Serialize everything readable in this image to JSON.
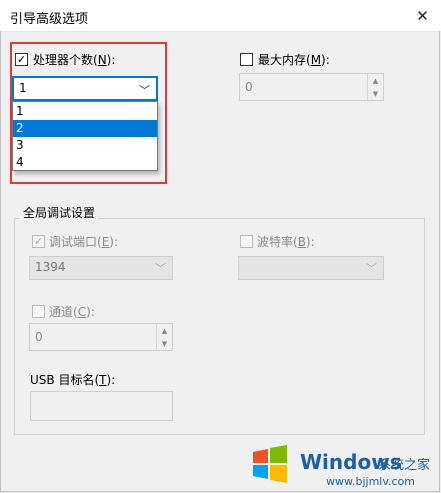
{
  "window": {
    "title": "引导高级选项",
    "close_glyph": "✕"
  },
  "processors": {
    "label_before": "处理器个数(",
    "label_key": "N",
    "label_after": "):",
    "checked": true,
    "selected": "1",
    "options": [
      "1",
      "2",
      "3",
      "4"
    ],
    "highlighted": "2"
  },
  "max_memory": {
    "label_before": "最大内存(",
    "label_key": "M",
    "label_after": "):",
    "checked": false,
    "value": "0"
  },
  "debug_settings": {
    "title": "全局调试设置",
    "debug_port": {
      "label_before": "调试端口(",
      "label_key": "E",
      "label_after": "):",
      "checked": true,
      "value": "1394"
    },
    "baud_rate": {
      "label_before": "波特率(",
      "label_key": "B",
      "label_after": "):",
      "checked": false,
      "value": ""
    },
    "channel": {
      "label_before": "通道(",
      "label_key": "C",
      "label_after": "):",
      "checked": false,
      "value": "0"
    },
    "usb_target": {
      "label_before": "USB 目标名(",
      "label_key": "T",
      "label_after": "):",
      "value": ""
    }
  },
  "watermark": {
    "brand": "Windows",
    "cn_text": "系统之家",
    "url": "www.bjjmlv.com",
    "colors": {
      "blue": "#1d5fa7",
      "red": "#f25022",
      "green": "#7fba00",
      "logo_blue": "#00a4ef",
      "yellow": "#ffb900"
    }
  },
  "colors": {
    "accent": "#0078d7",
    "highlight_border": "#e0393c"
  }
}
